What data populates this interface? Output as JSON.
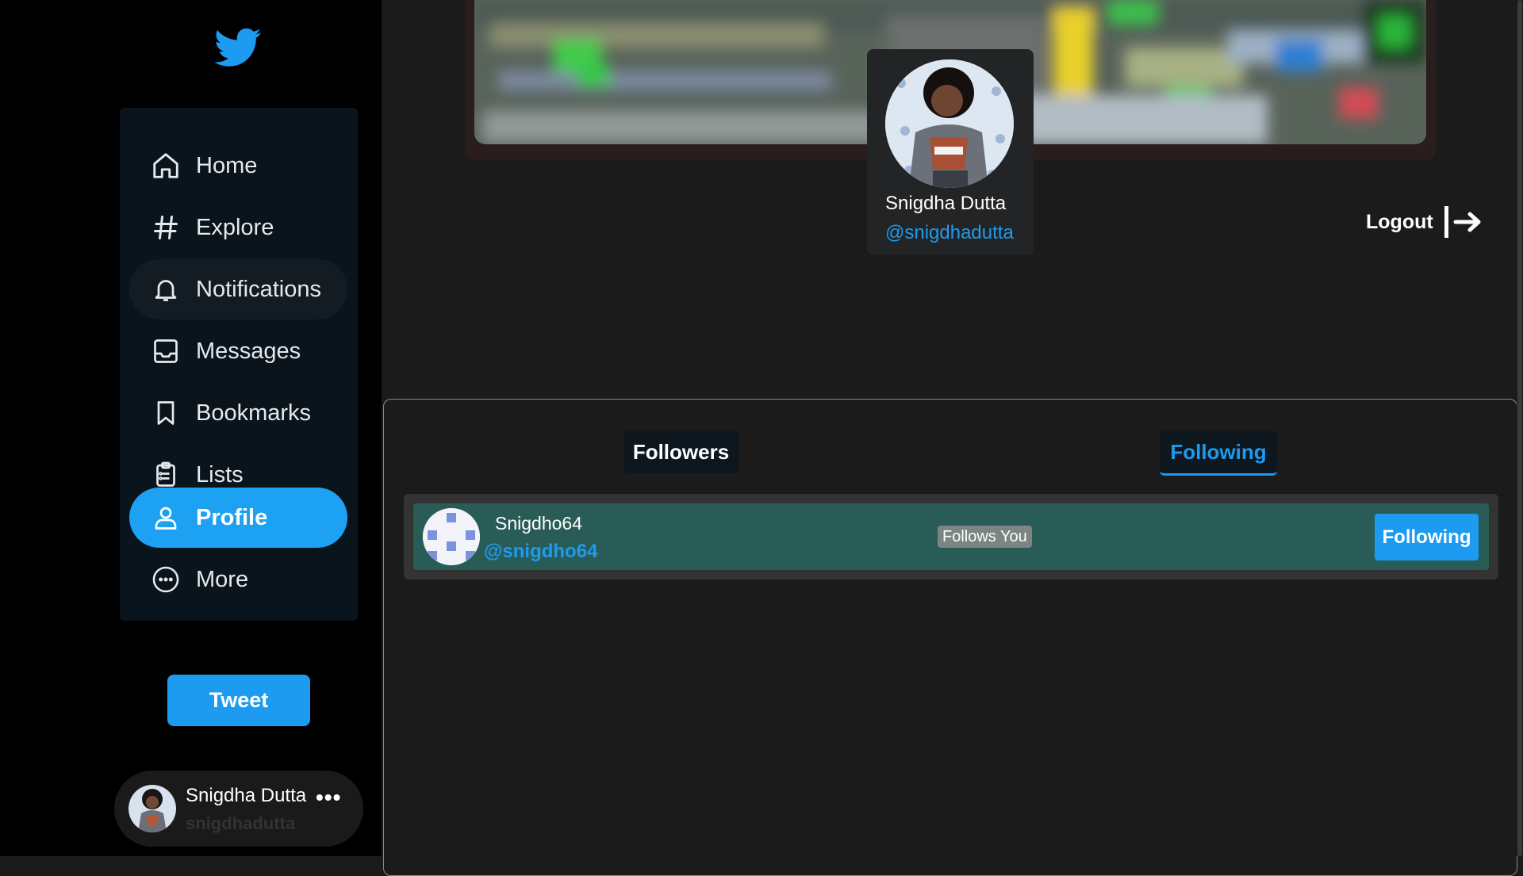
{
  "nav": {
    "items": [
      {
        "label": "Home",
        "icon": "home-icon"
      },
      {
        "label": "Explore",
        "icon": "hashtag-icon"
      },
      {
        "label": "Notifications",
        "icon": "bell-icon"
      },
      {
        "label": "Messages",
        "icon": "inbox-icon"
      },
      {
        "label": "Bookmarks",
        "icon": "bookmark-icon"
      },
      {
        "label": "Lists",
        "icon": "list-icon"
      },
      {
        "label": "Profile",
        "icon": "user-icon"
      },
      {
        "label": "More",
        "icon": "more-circle-icon"
      }
    ],
    "tweet_label": "Tweet"
  },
  "current_user": {
    "name": "Snigdha Dutta",
    "handle": "snigdhadutta",
    "more": "•••"
  },
  "profile": {
    "name": "Snigdha Dutta",
    "handle": "@snigdhadutta",
    "logout_label": "Logout"
  },
  "tabs": {
    "followers": "Followers",
    "following": "Following"
  },
  "following_list": [
    {
      "name": "Snigdho64",
      "handle": "@snigdho64",
      "badge": "Follows You",
      "button": "Following"
    }
  ],
  "colors": {
    "accent": "#1d9bf0",
    "row_bg": "#2a5c57"
  }
}
